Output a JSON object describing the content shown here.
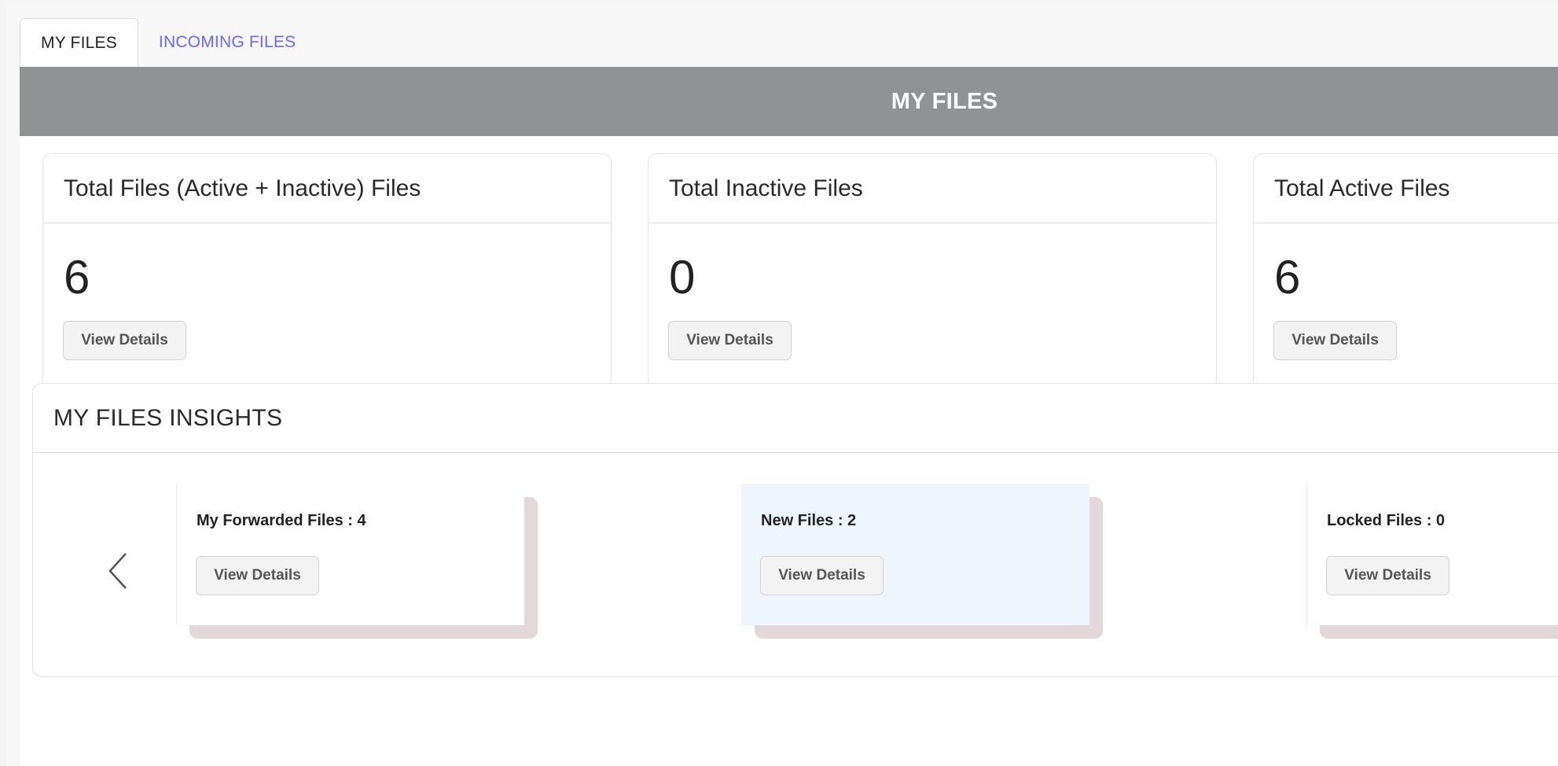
{
  "tabs": [
    {
      "label": "MY FILES",
      "active": true
    },
    {
      "label": "INCOMING FILES",
      "active": false
    }
  ],
  "panel": {
    "header": "MY FILES"
  },
  "stats": [
    {
      "title": "Total Files (Active + Inactive) Files",
      "value": "6",
      "button": "View Details"
    },
    {
      "title": "Total Inactive Files",
      "value": "0",
      "button": "View Details"
    },
    {
      "title": "Total Active Files",
      "value": "6",
      "button": "View Details"
    }
  ],
  "insights": {
    "title": "MY FILES INSIGHTS",
    "cards": [
      {
        "label": "My Forwarded Files : 4",
        "button": "View Details"
      },
      {
        "label": "New Files : 2",
        "button": "View Details"
      },
      {
        "label": "Locked Files : 0",
        "button": "View Details"
      }
    ]
  },
  "colors": {
    "header_bg": "#919293",
    "tab_link": "#6a68ff",
    "highlight_card": "#eef5fd",
    "card_shadow": "#e2d8da"
  },
  "icons": {
    "prev": "chevron-left-icon"
  }
}
